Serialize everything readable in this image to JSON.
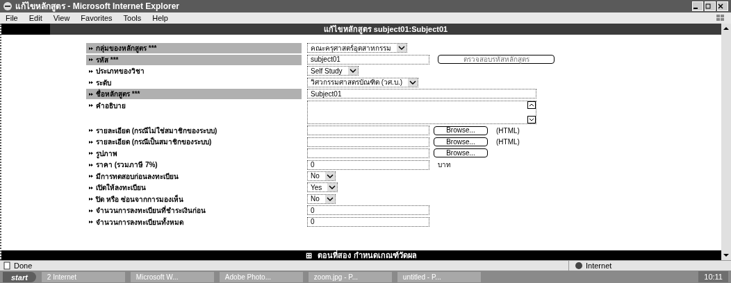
{
  "window": {
    "title": "แก้ไขหลักสูตร - Microsoft Internet Explorer"
  },
  "menu": [
    "File",
    "Edit",
    "View",
    "Favorites",
    "Tools",
    "Help"
  ],
  "header": "แก้ไขหลักสูตร subject01:Subject01",
  "fields": [
    {
      "label": "กลุ่มของหลักสูตร ***",
      "required": true,
      "kind": "select",
      "value": "คณะครุศาสตร์อุตสาหกรรม"
    },
    {
      "label": "รหัส ***",
      "required": true,
      "kind": "text",
      "value": "subject01",
      "button": "ตรวจสอบรหัสหลักสูตร"
    },
    {
      "label": "ประเภทของวิชา",
      "required": false,
      "kind": "select",
      "value": "Self Study"
    },
    {
      "label": "ระดับ",
      "required": false,
      "kind": "select",
      "value": "วิศวกรรมศาสตรบัณฑิต (วศ.บ.)"
    },
    {
      "label": "ชื่อหลักสูตร ***",
      "required": true,
      "kind": "text",
      "value": "Subject01",
      "wide": true
    },
    {
      "label": "คำอธิบาย",
      "required": false,
      "kind": "textarea"
    },
    {
      "label": "รายละเอียด (กรณีไม่ใช่สมาชิกของระบบ)",
      "required": false,
      "kind": "file",
      "button": "Browse...",
      "note": "(HTML)"
    },
    {
      "label": "รายละเอียด (กรณีเป็นสมาชิกของระบบ)",
      "required": false,
      "kind": "file",
      "button": "Browse...",
      "note": "(HTML)"
    },
    {
      "label": "รูปภาพ",
      "required": false,
      "kind": "file",
      "button": "Browse..."
    },
    {
      "label": "ราคา (รวมภาษี 7%)",
      "required": false,
      "kind": "text",
      "value": "0",
      "note": "บาท"
    },
    {
      "label": "มีการทดสอบก่อนลงทะเบียน",
      "required": false,
      "kind": "select",
      "value": "No"
    },
    {
      "label": "เปิดให้ลงทะเบียน",
      "required": false,
      "kind": "select",
      "value": "Yes"
    },
    {
      "label": "ปิด หรือ ซ่อนจากการมองเห็น",
      "required": false,
      "kind": "select",
      "value": "No"
    },
    {
      "label": "จำนวนการลงทะเบียนที่ชำระเงินก่อน",
      "required": false,
      "kind": "text",
      "value": "0"
    },
    {
      "label": "จำนวนการลงทะเบียนทั้งหมด",
      "required": false,
      "kind": "text",
      "value": "0"
    }
  ],
  "section_bar": {
    "icon": "⊞",
    "label": "ตอนที่สอง กำหนดเกณฑ์วัดผล"
  },
  "status_bar": {
    "status": "Done",
    "zone": "Internet"
  },
  "taskbar": {
    "start": "start",
    "items": [
      "2 Internet",
      "Microsoft W...",
      "Adobe Photo...",
      "zoom.jpg - P...",
      "untitled - P..."
    ],
    "clock": "10:11"
  }
}
